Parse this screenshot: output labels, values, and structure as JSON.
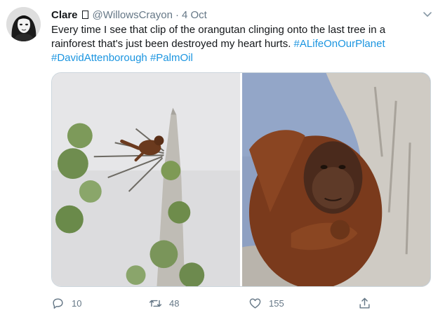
{
  "tweet": {
    "author_name": "Clare",
    "author_handle": "@WillowsCrayon",
    "separator": "·",
    "date": "4 Oct",
    "text_plain": "Every time I see that clip of the orangutan clinging onto the last tree in a rainforest that's just been destroyed my heart hurts.",
    "hashtags": [
      "#ALifeOnOurPlanet",
      "#DavidAttenborough",
      "#PalmOil"
    ]
  },
  "media": {
    "photos": [
      "orangutan-in-stripped-tree",
      "orangutan-closeup-on-trunk"
    ]
  },
  "actions": {
    "reply_count": "10",
    "retweet_count": "48",
    "like_count": "155"
  },
  "icons": {
    "caret": "chevron-down-icon",
    "reply": "reply-icon",
    "retweet": "retweet-icon",
    "like": "heart-icon",
    "share": "share-icon"
  },
  "colors": {
    "text": "#14171a",
    "secondary": "#657786",
    "hashtag": "#1b95e0",
    "border": "#ccd6dd"
  }
}
